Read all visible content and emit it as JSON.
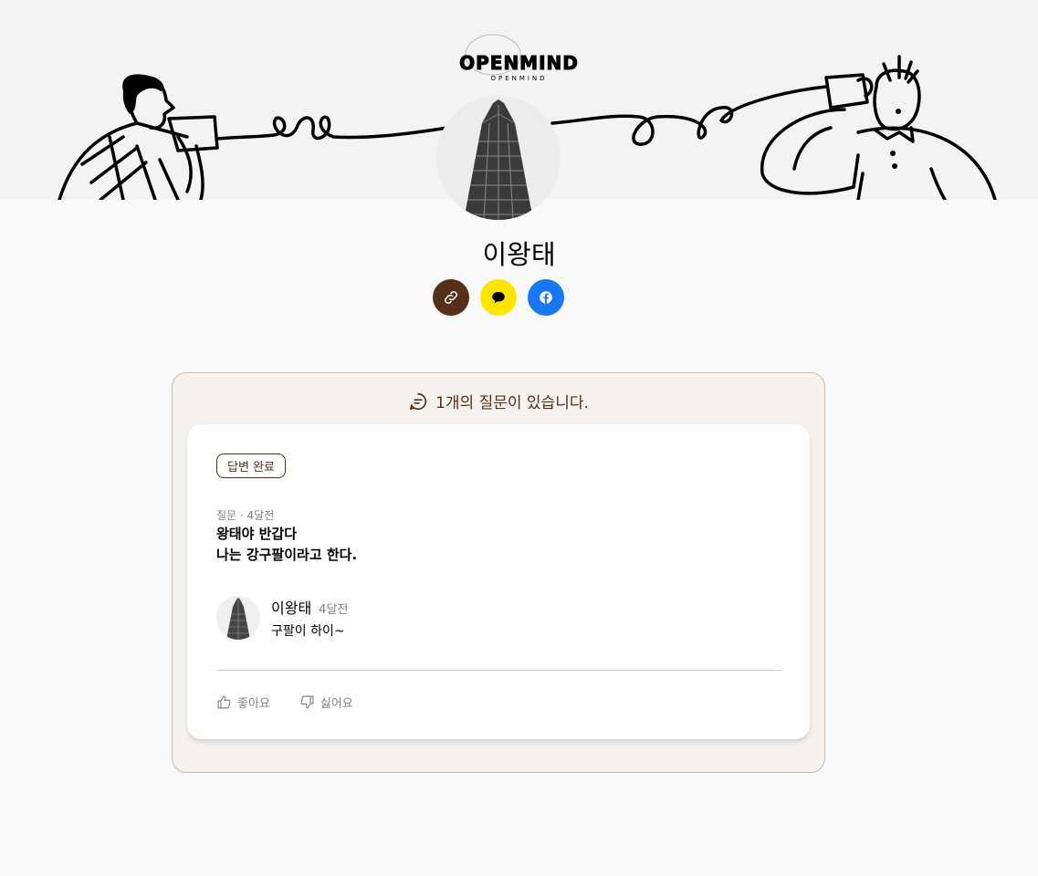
{
  "header": {
    "logo_main": "OPENMIND",
    "logo_sub": "OPENMIND"
  },
  "profile": {
    "name": "이왕태"
  },
  "share": {
    "link_icon": "link-icon",
    "kakao_icon": "kakao-talk-icon",
    "facebook_icon": "facebook-icon",
    "colors": {
      "link": "#542f1a",
      "kakao": "#fee500",
      "facebook": "#1877f2"
    }
  },
  "feed": {
    "header_icon": "messages-icon",
    "header_text": "1개의 질문이 있습니다.",
    "questions": [
      {
        "badge": "답변 완료",
        "meta": "질문 · 4달전",
        "question_line1": "왕태야 반갑다",
        "question_line2": "나는 강구팔이라고 한다.",
        "answer": {
          "name": "이왕태",
          "time": "4달전",
          "text": "구팔이 하이~"
        },
        "like_label": "좋아요",
        "dislike_label": "싫어요"
      }
    ]
  },
  "colors": {
    "brown": "#542f1a",
    "feed_bg": "#f5f1ee",
    "page_bg": "#f9f9f9"
  }
}
